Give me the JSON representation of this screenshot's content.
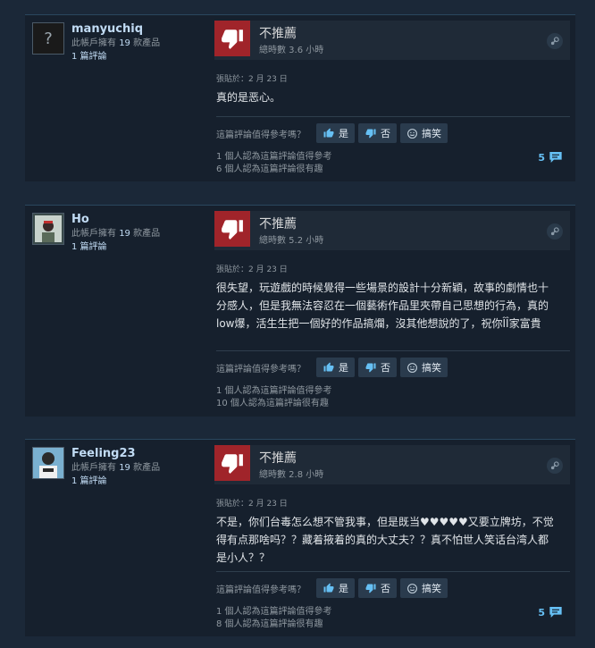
{
  "reviews": [
    {
      "username": "manyuchiq",
      "products_prefix": "此帳戶擁有 ",
      "products_count": "19",
      "products_suffix": " 款產品",
      "reviews_count": "1 篇評論",
      "verdict": "不推薦",
      "hours": "總時數 3.6 小時",
      "posted": "張貼於：2 月 23 日",
      "content": "真的是恶心。",
      "helpful_question": "這篇評論值得參考嗎？",
      "btn_yes": "是",
      "btn_no": "否",
      "btn_funny": "搞笑",
      "helpful_count_text": "1 個人認為這篇評論值得參考",
      "funny_count_text": "6 個人認為這篇評論很有趣",
      "comment_count": "5"
    },
    {
      "username": "Ho",
      "products_prefix": "此帳戶擁有 ",
      "products_count": "19",
      "products_suffix": " 款產品",
      "reviews_count": "1 篇評論",
      "verdict": "不推薦",
      "hours": "總時數 5.2 小時",
      "posted": "張貼於：2 月 23 日",
      "content": "很失望，玩遊戲的時候覺得一些場景的設計十分新穎，故事的劇情也十分感人，但是我無法容忍在一個藝術作品里夾帶自己思想的行為，真的low爆，活生生把一個好的作品搞爛，沒其他想說的了，祝你ÎÎ家富貴",
      "helpful_question": "這篇評論值得參考嗎？",
      "btn_yes": "是",
      "btn_no": "否",
      "btn_funny": "搞笑",
      "helpful_count_text": "1 個人認為這篇評論值得參考",
      "funny_count_text": "10 個人認為這篇評論很有趣"
    },
    {
      "username": "Feeling23",
      "products_prefix": "此帳戶擁有 ",
      "products_count": "19",
      "products_suffix": " 款產品",
      "reviews_count": "1 篇評論",
      "verdict": "不推薦",
      "hours": "總時數 2.8 小時",
      "posted": "張貼於：2 月 23 日",
      "content": "不是，你们台毒怎么想不管我事，但是既当♥♥♥♥♥又要立牌坊，不觉得有点那啥吗？？藏着掖着的真的大丈夫？？真不怕世人笑话台湾人都是小人？？",
      "helpful_question": "這篇評論值得參考嗎？",
      "btn_yes": "是",
      "btn_no": "否",
      "btn_funny": "搞笑",
      "helpful_count_text": "1 個人認為這篇評論值得參考",
      "funny_count_text": "8 個人認為這篇評論很有趣",
      "comment_count": "5"
    }
  ],
  "colors": {
    "background": "#1b2838",
    "review_bg": "#16202d",
    "thumb_down": "#a0242a",
    "link": "#66c0f4"
  },
  "icons": [
    "thumbs-down-icon",
    "steam-logo-icon",
    "thumbs-up-icon",
    "smiley-icon",
    "comment-icon"
  ]
}
